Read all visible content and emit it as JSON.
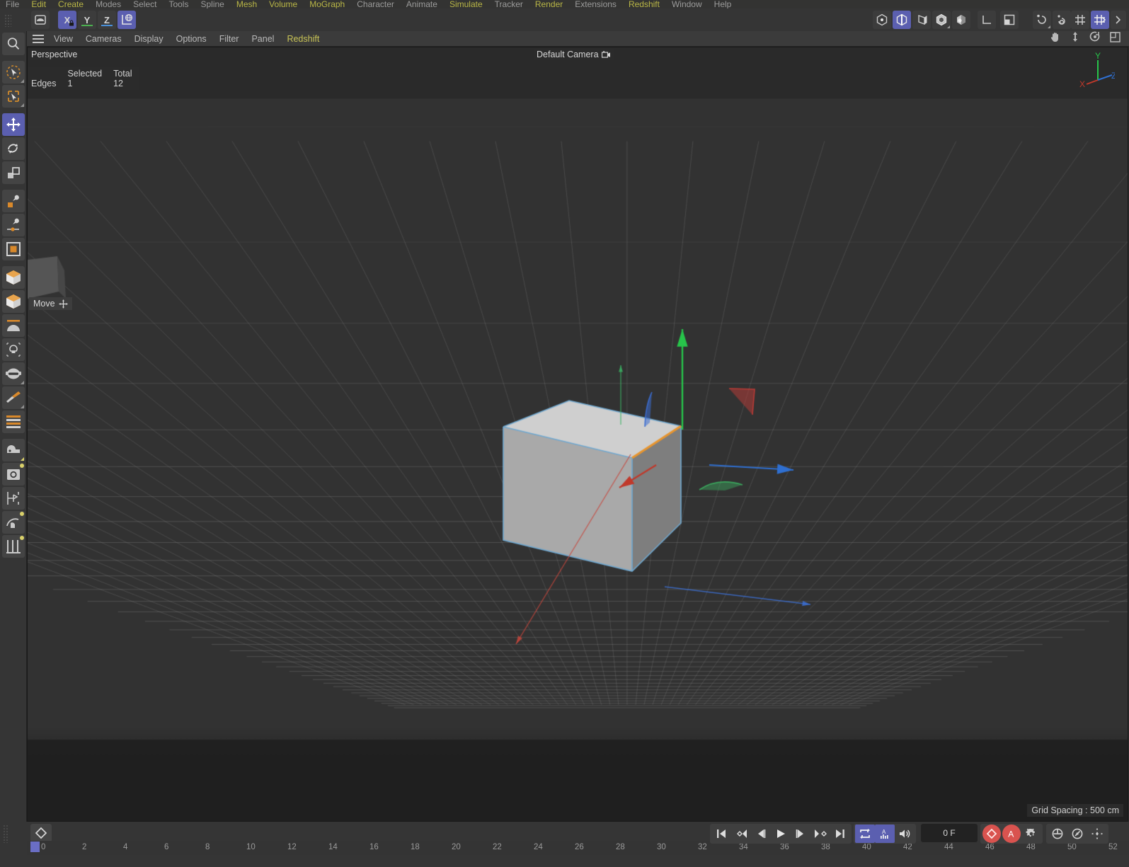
{
  "app": {
    "title": "Cinema 4D",
    "menubar": [
      {
        "label": "File",
        "hl": false
      },
      {
        "label": "Edit",
        "hl": true
      },
      {
        "label": "Create",
        "hl": true
      },
      {
        "label": "Modes",
        "hl": false
      },
      {
        "label": "Select",
        "hl": false
      },
      {
        "label": "Tools",
        "hl": false
      },
      {
        "label": "Spline",
        "hl": false
      },
      {
        "label": "Mesh",
        "hl": true
      },
      {
        "label": "Volume",
        "hl": true
      },
      {
        "label": "MoGraph",
        "hl": true
      },
      {
        "label": "Character",
        "hl": false
      },
      {
        "label": "Animate",
        "hl": false
      },
      {
        "label": "Simulate",
        "hl": true
      },
      {
        "label": "Tracker",
        "hl": false
      },
      {
        "label": "Render",
        "hl": true
      },
      {
        "label": "Extensions",
        "hl": false
      },
      {
        "label": "Redshift",
        "hl": true
      },
      {
        "label": "Window",
        "hl": false
      },
      {
        "label": "Help",
        "hl": false
      }
    ]
  },
  "toolbar": {
    "undo_redo_label": "undo-redo",
    "axis_buttons": [
      {
        "name": "x-axis-lock-button",
        "label": "X",
        "active": true,
        "underline": "x"
      },
      {
        "name": "y-axis-lock-button",
        "label": "Y",
        "active": false,
        "underline": "g"
      },
      {
        "name": "z-axis-lock-button",
        "label": "Z",
        "active": false,
        "underline": "b"
      }
    ],
    "world_object_label": "World / Object coordinate system",
    "mode_icons": [
      "point-mode-icon",
      "edge-mode-icon",
      "polygon-mode-icon",
      "model-mode-icon",
      "texture-mode-icon"
    ],
    "axis_icons": [
      "object-axis-icon",
      "viewport-solo-icon"
    ],
    "snap_icons": [
      "enable-snapping-icon",
      "snap-settings-icon"
    ],
    "grid_icons": [
      "workplane-icon",
      "workplane-lock-icon"
    ]
  },
  "left_tools": [
    {
      "name": "search-tool",
      "label": "Search"
    },
    {
      "name": "live-selection-tool",
      "label": "Live Selection"
    },
    {
      "name": "box-select-tool",
      "label": "Box Select"
    },
    {
      "name": "move-tool",
      "label": "Move",
      "active": true
    },
    {
      "name": "rotate-tool",
      "label": "Rotate"
    },
    {
      "name": "scale-tool",
      "label": "Scale"
    },
    {
      "name": "create-point-tool",
      "label": "Create Point"
    },
    {
      "name": "knife-point-tool",
      "label": "Knife Point"
    },
    {
      "name": "selection-frame-tool",
      "label": "Selection Frame"
    },
    {
      "name": "cube-primitive-tool",
      "label": "Cube"
    },
    {
      "name": "subdivision-surface-tool",
      "label": "Subdivision Surface"
    },
    {
      "name": "bend-deformer-tool",
      "label": "Bend Deformer"
    },
    {
      "name": "light-tool",
      "label": "Light"
    },
    {
      "name": "camera-tool",
      "label": "Camera"
    },
    {
      "name": "knife-tool",
      "label": "Knife"
    },
    {
      "name": "array-tool",
      "label": "Array"
    },
    {
      "name": "mograph-cloner-tool",
      "label": "Cloner"
    },
    {
      "name": "render-view-tool",
      "label": "Render View"
    },
    {
      "name": "render-settings-tool",
      "label": "Render Settings"
    },
    {
      "name": "deformer-tool",
      "label": "Deformer"
    },
    {
      "name": "content-browser-tool",
      "label": "Content Browser"
    }
  ],
  "viewport_menu": {
    "items": [
      {
        "label": "View",
        "hl": false
      },
      {
        "label": "Cameras",
        "hl": false
      },
      {
        "label": "Display",
        "hl": false
      },
      {
        "label": "Options",
        "hl": false
      },
      {
        "label": "Filter",
        "hl": false
      },
      {
        "label": "Panel",
        "hl": false
      },
      {
        "label": "Redshift",
        "hl": true
      }
    ],
    "right_icons": [
      "pan-view-icon",
      "dolly-view-icon",
      "orbit-view-icon",
      "maximize-view-icon"
    ]
  },
  "viewport": {
    "projection_label": "Perspective",
    "camera_label": "Default Camera",
    "camera_icon": "camera-icon",
    "stats": {
      "header_selected": "Selected",
      "header_total": "Total",
      "rows": [
        {
          "label": "Edges",
          "selected": "1",
          "total": "12"
        }
      ]
    },
    "tooltip": {
      "label": "Move",
      "icon": "move-cross-icon"
    },
    "grid_spacing": "Grid Spacing : 500 cm",
    "axis_gizmo": {
      "x": "X",
      "y": "Y",
      "z": "Z"
    },
    "colors": {
      "bg": "#2e2e2e",
      "grid": "#4a4a4a",
      "cube_top": "#cfcfcf",
      "cube_left": "#a9a9a9",
      "cube_right": "#7e7e7e",
      "selected_edge": "#e8952e",
      "outline": "#6fa8d0",
      "axis_x": "#c0392b",
      "axis_y": "#27c44a",
      "axis_z": "#2f6fd0"
    }
  },
  "timeline": {
    "key_button_icon": "keyframe-diamond-icon",
    "current_frame": "0 F",
    "playhead_frame": 0,
    "ticks": [
      0,
      2,
      4,
      6,
      8,
      10,
      12,
      14,
      16,
      18,
      20,
      22,
      24,
      26,
      28,
      30,
      32,
      34,
      36,
      38,
      40,
      42,
      44,
      46,
      48,
      50,
      52
    ],
    "transport": [
      {
        "name": "go-to-start-button",
        "icon": "skip-start-icon"
      },
      {
        "name": "previous-key-button",
        "icon": "prev-key-icon"
      },
      {
        "name": "previous-frame-button",
        "icon": "prev-frame-icon"
      },
      {
        "name": "play-button",
        "icon": "play-icon"
      },
      {
        "name": "next-frame-button",
        "icon": "next-frame-icon"
      },
      {
        "name": "next-key-button",
        "icon": "next-key-icon"
      },
      {
        "name": "go-to-end-button",
        "icon": "skip-end-icon"
      }
    ],
    "toggles": [
      {
        "name": "loop-playback-toggle",
        "icon": "loop-icon",
        "active": true
      },
      {
        "name": "sound-track-toggle",
        "icon": "audio-track-icon",
        "active": true
      },
      {
        "name": "mute-toggle",
        "icon": "speaker-icon",
        "active": false
      }
    ],
    "record_buttons": [
      {
        "name": "record-keyframe-button",
        "icon": "record-diamond-icon",
        "style": "red"
      },
      {
        "name": "autokeying-button",
        "icon": "autokey-a-icon",
        "style": "red"
      },
      {
        "name": "keyframe-settings-button",
        "icon": "gear-icon",
        "style": "plain"
      }
    ],
    "extra_buttons": [
      {
        "name": "position-key-button",
        "icon": "position-key-icon"
      },
      {
        "name": "rotation-key-button",
        "icon": "rotation-key-icon"
      },
      {
        "name": "scale-key-button",
        "icon": "scale-key-icon"
      }
    ]
  }
}
